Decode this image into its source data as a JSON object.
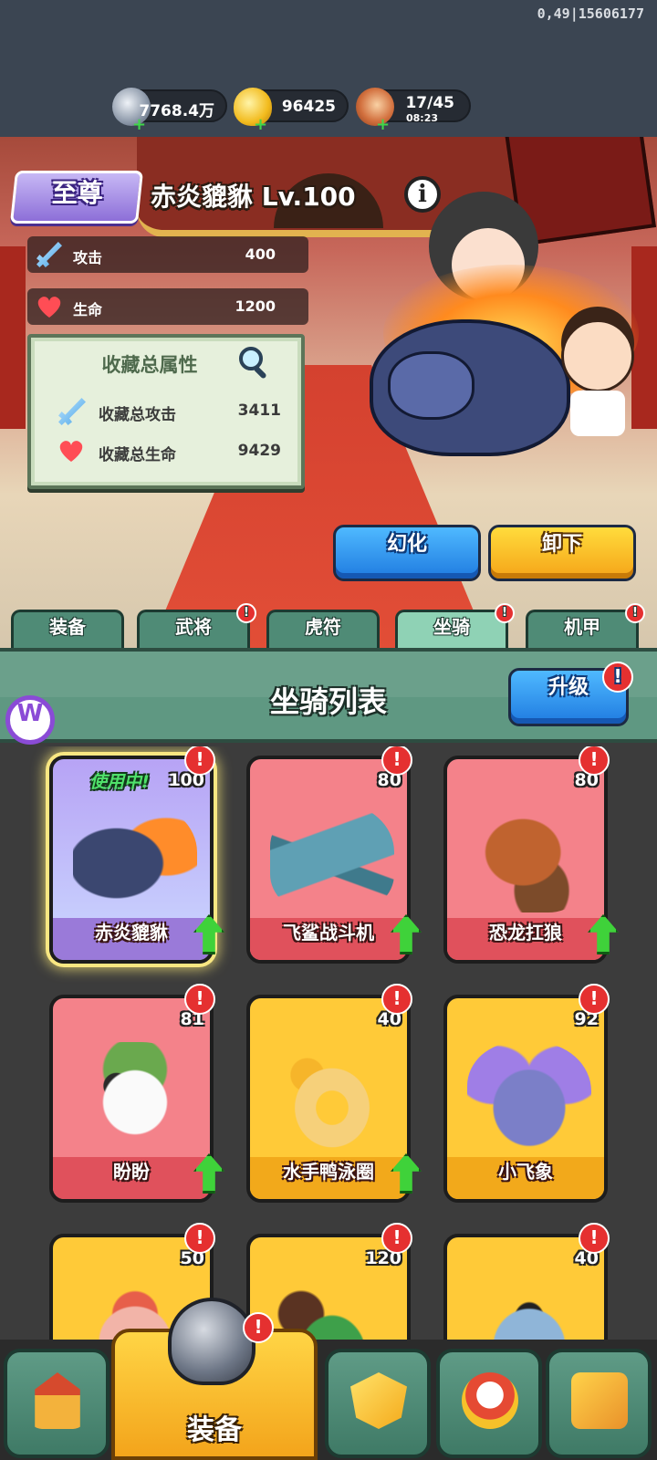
{
  "debug_overlay": "0,49|15606177",
  "currencies": [
    {
      "icon": "silver-coin-icon",
      "value": "7768.4万"
    },
    {
      "icon": "gold-ingot-icon",
      "value": "96425"
    },
    {
      "icon": "drumstick-icon",
      "value": "17/45",
      "timer": "08:23"
    }
  ],
  "mount": {
    "rank": "至尊",
    "name": "赤炎貔貅 Lv.100",
    "stats": [
      {
        "icon": "sword-icon",
        "label": "攻击",
        "value": "400"
      },
      {
        "icon": "heart-icon",
        "label": "生命",
        "value": "1200"
      }
    ]
  },
  "collection": {
    "title": "收藏总属性",
    "rows": [
      {
        "icon": "sword-icon",
        "label": "收藏总攻击",
        "value": "3411"
      },
      {
        "icon": "heart-icon",
        "label": "收藏总生命",
        "value": "9429"
      }
    ]
  },
  "actions": {
    "transform": "幻化",
    "unload": "卸下"
  },
  "tabs": [
    {
      "label": "装备",
      "badge": false,
      "active": false
    },
    {
      "label": "武将",
      "badge": true,
      "active": false
    },
    {
      "label": "虎符",
      "badge": false,
      "active": false
    },
    {
      "label": "坐骑",
      "badge": true,
      "active": true
    },
    {
      "label": "机甲",
      "badge": true,
      "active": false
    }
  ],
  "list": {
    "title": "坐骑列表",
    "upgrade": "升级",
    "badge": "!",
    "in_use": "使用中!"
  },
  "cards": [
    {
      "name": "赤炎貔貅",
      "level": "100",
      "color": "purple",
      "in_use": true,
      "arrow": true
    },
    {
      "name": "飞鲨战斗机",
      "level": "80",
      "color": "pink",
      "in_use": false,
      "arrow": true
    },
    {
      "name": "恐龙扛狼",
      "level": "80",
      "color": "pink",
      "in_use": false,
      "arrow": true
    },
    {
      "name": "盼盼",
      "level": "81",
      "color": "pink",
      "in_use": false,
      "arrow": true
    },
    {
      "name": "水手鸭泳圈",
      "level": "40",
      "color": "yellow",
      "in_use": false,
      "arrow": true
    },
    {
      "name": "小飞象",
      "level": "92",
      "color": "yellow",
      "in_use": false,
      "arrow": false
    },
    {
      "name": "",
      "level": "50",
      "color": "yellow",
      "in_use": false,
      "arrow": false
    },
    {
      "name": "",
      "level": "120",
      "color": "yellow",
      "in_use": false,
      "arrow": false
    },
    {
      "name": "",
      "level": "40",
      "color": "yellow",
      "in_use": false,
      "arrow": false
    }
  ],
  "bottom_nav": {
    "active_label": "装备"
  }
}
